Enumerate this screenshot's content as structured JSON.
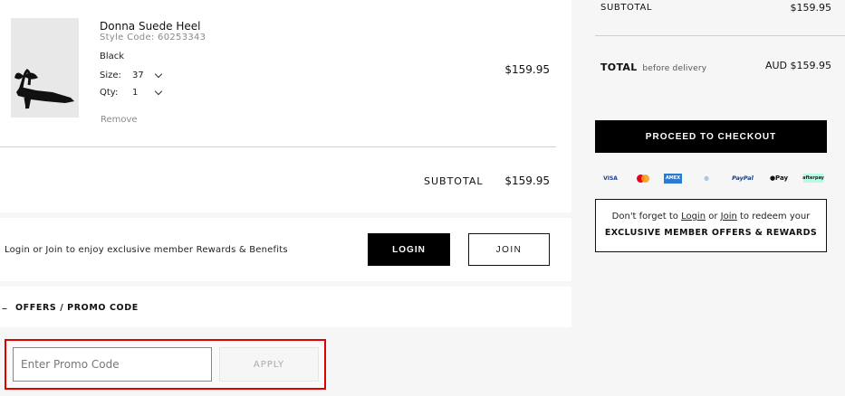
{
  "product": {
    "name": "Donna Suede Heel",
    "style_code": "Style Code: 60253343",
    "color": "Black",
    "size_label": "Size:",
    "size_value": "37",
    "qty_label": "Qty:",
    "qty_value": "1",
    "remove_label": "Remove",
    "price": "$159.95"
  },
  "subtotal": {
    "label": "SUBTOTAL",
    "value": "$159.95"
  },
  "member": {
    "text": "Login or Join to enjoy exclusive member Rewards & Benefits",
    "login_label": "LOGIN",
    "join_label": "JOIN"
  },
  "offers": {
    "toggle_symbol": "–",
    "label": "OFFERS / PROMO CODE",
    "input_placeholder": "Enter Promo Code",
    "apply_label": "APPLY"
  },
  "summary": {
    "subtotal_label": "SUBTOTAL",
    "subtotal_value": "$159.95",
    "total_label": "TOTAL",
    "total_suffix": "before delivery",
    "total_value": "AUD $159.95",
    "checkout_label": "PROCEED TO CHECKOUT",
    "payments": [
      "VISA",
      "Mastercard",
      "AMEX",
      "Diners",
      "PayPal",
      "Pay",
      "afterpay"
    ],
    "rewards_pre": "Don't forget to ",
    "rewards_login": "Login",
    "rewards_or": " or ",
    "rewards_join": "Join",
    "rewards_post": " to redeem your",
    "rewards_line2": "EXCLUSIVE MEMBER OFFERS & REWARDS"
  },
  "colors": {
    "accent_black": "#000000",
    "highlight_red": "#e00000"
  }
}
